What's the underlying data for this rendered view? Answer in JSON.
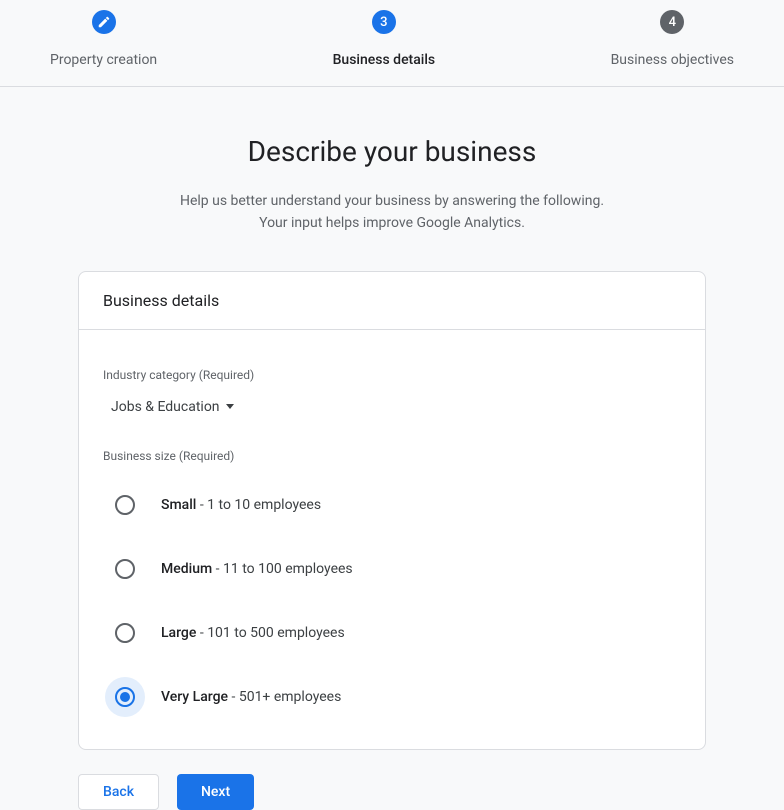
{
  "stepper": {
    "steps": [
      {
        "label": "Property creation",
        "state": "completed",
        "value": ""
      },
      {
        "label": "Business details",
        "state": "active",
        "value": "3"
      },
      {
        "label": "Business objectives",
        "state": "future",
        "value": "4"
      }
    ]
  },
  "heading": "Describe your business",
  "subline1": "Help us better understand your business by answering the following.",
  "subline2": "Your input helps improve Google Analytics.",
  "card": {
    "title": "Business details",
    "industry": {
      "label": "Industry category (Required)",
      "value": "Jobs & Education"
    },
    "size": {
      "label": "Business size (Required)",
      "options": [
        {
          "name": "Small",
          "desc": " - 1 to 10 employees",
          "selected": false
        },
        {
          "name": "Medium",
          "desc": " - 11 to 100 employees",
          "selected": false
        },
        {
          "name": "Large",
          "desc": " - 101 to 500 employees",
          "selected": false
        },
        {
          "name": "Very Large",
          "desc": " - 501+ employees",
          "selected": true
        }
      ]
    }
  },
  "actions": {
    "back": "Back",
    "next": "Next"
  }
}
